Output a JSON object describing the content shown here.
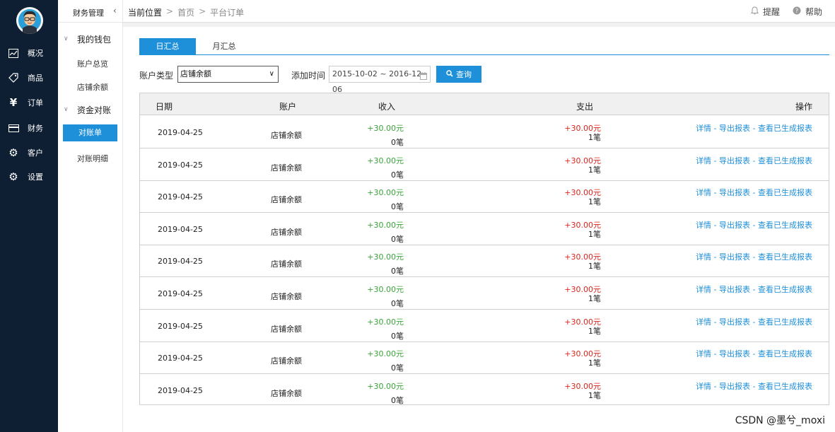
{
  "nav": {
    "items": [
      {
        "label": "概况",
        "icon": "chart-line-icon"
      },
      {
        "label": "商品",
        "icon": "shopping-tag-icon"
      },
      {
        "label": "订单",
        "icon": "yen-icon"
      },
      {
        "label": "财务",
        "icon": "credit-card-icon"
      },
      {
        "label": "客户",
        "icon": "gear-icon"
      },
      {
        "label": "设置",
        "icon": "gear-icon"
      }
    ]
  },
  "sidebar": {
    "title": "财务管理",
    "groups": [
      {
        "label": "我的钱包",
        "items": [
          "账户总览",
          "店铺余额"
        ]
      },
      {
        "label": "资金对账",
        "items": [
          "对账单",
          "对账明细"
        ]
      }
    ],
    "active_item": "对账单"
  },
  "topbar": {
    "breadcrumb": [
      "当前位置",
      "首页",
      "平台订单"
    ],
    "separator": ">",
    "remind_label": "提醒",
    "help_label": "帮助"
  },
  "tabs": [
    {
      "label": "日汇总",
      "active": true
    },
    {
      "label": "月汇总",
      "active": false
    }
  ],
  "filter": {
    "account_type_label": "账户类型",
    "account_type_value": "店铺余额",
    "add_time_label": "添加时间",
    "date_range": "2015-10-02 ~ 2016-12-06",
    "query_button": "查询"
  },
  "table": {
    "headers": [
      "日期",
      "账户",
      "收入",
      "支出",
      "操作"
    ],
    "rows": [
      {
        "date": "2019-04-25",
        "account": "店铺余额",
        "income": "+30.00元",
        "income_count": "0笔",
        "expense": "+30.00元",
        "expense_count": "1笔",
        "ops": "详情 - 导出报表 - 查看已生成报表"
      },
      {
        "date": "2019-04-25",
        "account": "店铺余额",
        "income": "+30.00元",
        "income_count": "0笔",
        "expense": "+30.00元",
        "expense_count": "1笔",
        "ops": "详情 - 导出报表 - 查看已生成报表"
      },
      {
        "date": "2019-04-25",
        "account": "店铺余额",
        "income": "+30.00元",
        "income_count": "0笔",
        "expense": "+30.00元",
        "expense_count": "1笔",
        "ops": "详情 - 导出报表 - 查看已生成报表"
      },
      {
        "date": "2019-04-25",
        "account": "店铺余额",
        "income": "+30.00元",
        "income_count": "0笔",
        "expense": "+30.00元",
        "expense_count": "1笔",
        "ops": "详情 - 导出报表 - 查看已生成报表"
      },
      {
        "date": "2019-04-25",
        "account": "店铺余额",
        "income": "+30.00元",
        "income_count": "0笔",
        "expense": "+30.00元",
        "expense_count": "1笔",
        "ops": "详情 - 导出报表 - 查看已生成报表"
      },
      {
        "date": "2019-04-25",
        "account": "店铺余额",
        "income": "+30.00元",
        "income_count": "0笔",
        "expense": "+30.00元",
        "expense_count": "1笔",
        "ops": "详情 - 导出报表 - 查看已生成报表"
      },
      {
        "date": "2019-04-25",
        "account": "店铺余额",
        "income": "+30.00元",
        "income_count": "0笔",
        "expense": "+30.00元",
        "expense_count": "1笔",
        "ops": "详情 - 导出报表 - 查看已生成报表"
      },
      {
        "date": "2019-04-25",
        "account": "店铺余额",
        "income": "+30.00元",
        "income_count": "0笔",
        "expense": "+30.00元",
        "expense_count": "1笔",
        "ops": "详情 - 导出报表 - 查看已生成报表"
      },
      {
        "date": "2019-04-25",
        "account": "店铺余额",
        "income": "+30.00元",
        "income_count": "0笔",
        "expense": "+30.00元",
        "expense_count": "1笔",
        "ops": "详情 - 导出报表 - 查看已生成报表"
      }
    ]
  },
  "watermark": "CSDN @墨兮_moxi",
  "colors": {
    "nav_bg": "#0f1f33",
    "accent": "#1e8fd9",
    "income": "#39a339",
    "expense": "#d9261c"
  }
}
